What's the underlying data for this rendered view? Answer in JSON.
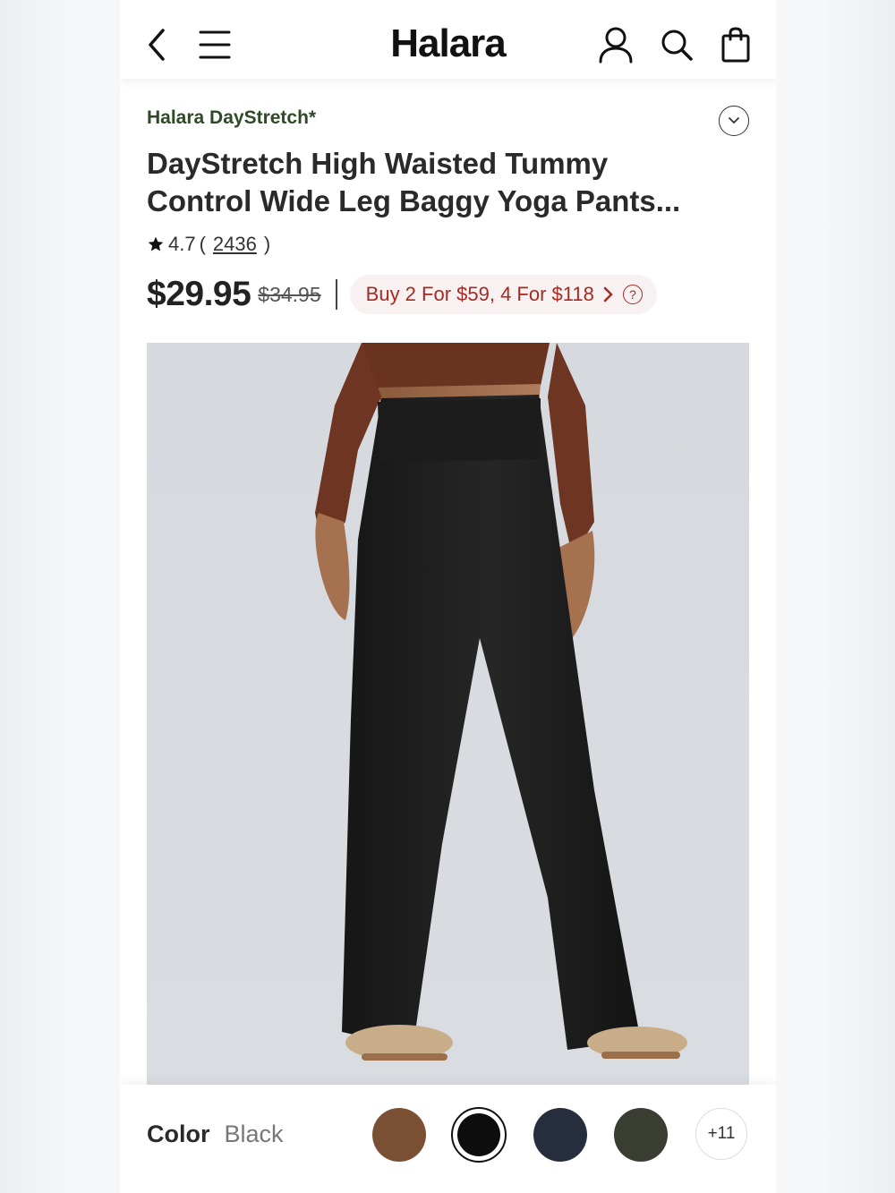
{
  "header": {
    "logo": "Halara",
    "icons": [
      "back-icon",
      "menu-icon",
      "account-icon",
      "search-icon",
      "bag-icon"
    ]
  },
  "product": {
    "brand": "Halara DayStretch*",
    "title": "DayStretch High Waisted Tummy Control Wide Leg Baggy Yoga Pants...",
    "rating": "4.7",
    "rating_open": "(",
    "review_count": "2436",
    "rating_close": ")",
    "price": "$29.95",
    "original_price": "$34.95",
    "promo": "Buy 2 For $59, 4 For $118",
    "promo_help": "?"
  },
  "color": {
    "label": "Color",
    "selected": "Black",
    "swatches": [
      {
        "name": "brown",
        "hex": "#7a5034"
      },
      {
        "name": "black",
        "hex": "#0d0d0d",
        "selected": true
      },
      {
        "name": "navy",
        "hex": "#262d3d"
      },
      {
        "name": "olive",
        "hex": "#3a3d32"
      }
    ],
    "more": "+11"
  },
  "colors": {
    "promo_text": "#a62a22",
    "brand_text": "#2f4a26",
    "image_bg": "#d6dadf"
  }
}
